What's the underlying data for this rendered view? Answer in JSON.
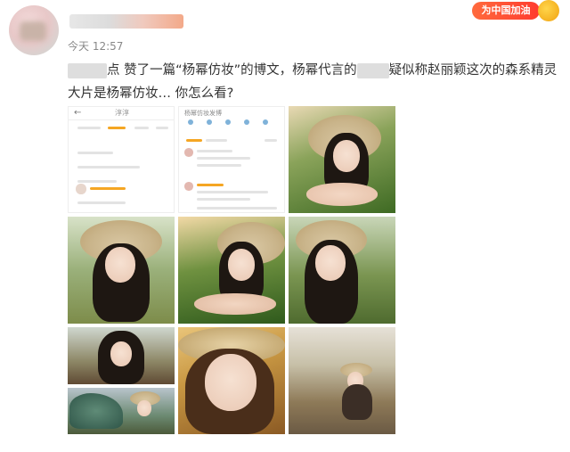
{
  "post": {
    "time": "今天 12:57",
    "badge_text": "为中国加油",
    "text_part1": "点 赞了一篇“杨幂仿妆”的博文，杨幂代言的",
    "text_part2": "疑似称赵丽颖这次的森系精灵大片是杨幂仿妆… 你怎么看?"
  },
  "screenshot": {
    "header": "淳淳",
    "title2": "杨幂仿妆发博"
  },
  "colors": {
    "accent": "#f5a623",
    "badge": "#ff3b2f"
  }
}
